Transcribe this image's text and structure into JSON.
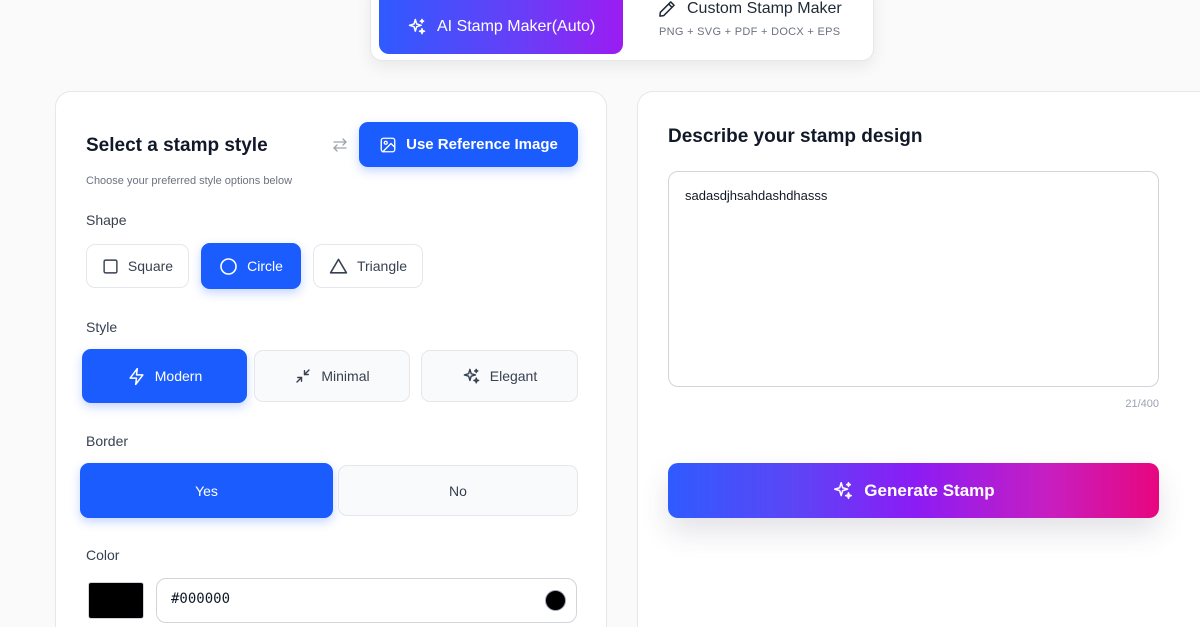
{
  "mode_switch": {
    "ai_label": "AI Stamp Maker(Auto)",
    "custom_label": "Custom Stamp Maker",
    "custom_formats": "PNG + SVG + PDF + DOCX + EPS"
  },
  "style_panel": {
    "title": "Select a stamp style",
    "subtitle": "Choose your preferred style options below",
    "reference_button": "Use Reference Image",
    "shape": {
      "label": "Shape",
      "options": [
        "Square",
        "Circle",
        "Triangle"
      ],
      "selected": "Circle"
    },
    "style": {
      "label": "Style",
      "options": [
        "Modern",
        "Minimal",
        "Elegant"
      ],
      "selected": "Modern"
    },
    "border": {
      "label": "Border",
      "options": [
        "Yes",
        "No"
      ],
      "selected": "Yes"
    },
    "color": {
      "label": "Color",
      "value": "#000000"
    }
  },
  "design_panel": {
    "title": "Describe your stamp design",
    "description": "sadasdjhsahdashdhasss",
    "counter": "21/400",
    "generate_button": "Generate Stamp"
  },
  "theme": {
    "accent": "#1b5cff",
    "gradient_start": "#2f5bff",
    "gradient_mid": "#8b1cf5",
    "gradient_end": "#e8067f"
  },
  "icons": {
    "ai_mode": "sparkles-icon",
    "custom_mode": "pencil-icon",
    "swap": "swap-arrows-icon",
    "reference": "image-icon",
    "square": "square-icon",
    "circle": "circle-icon",
    "triangle": "triangle-icon",
    "modern": "lightning-icon",
    "minimal": "minimize-arrows-icon",
    "elegant": "sparkles-icon",
    "generate": "sparkles-icon"
  }
}
